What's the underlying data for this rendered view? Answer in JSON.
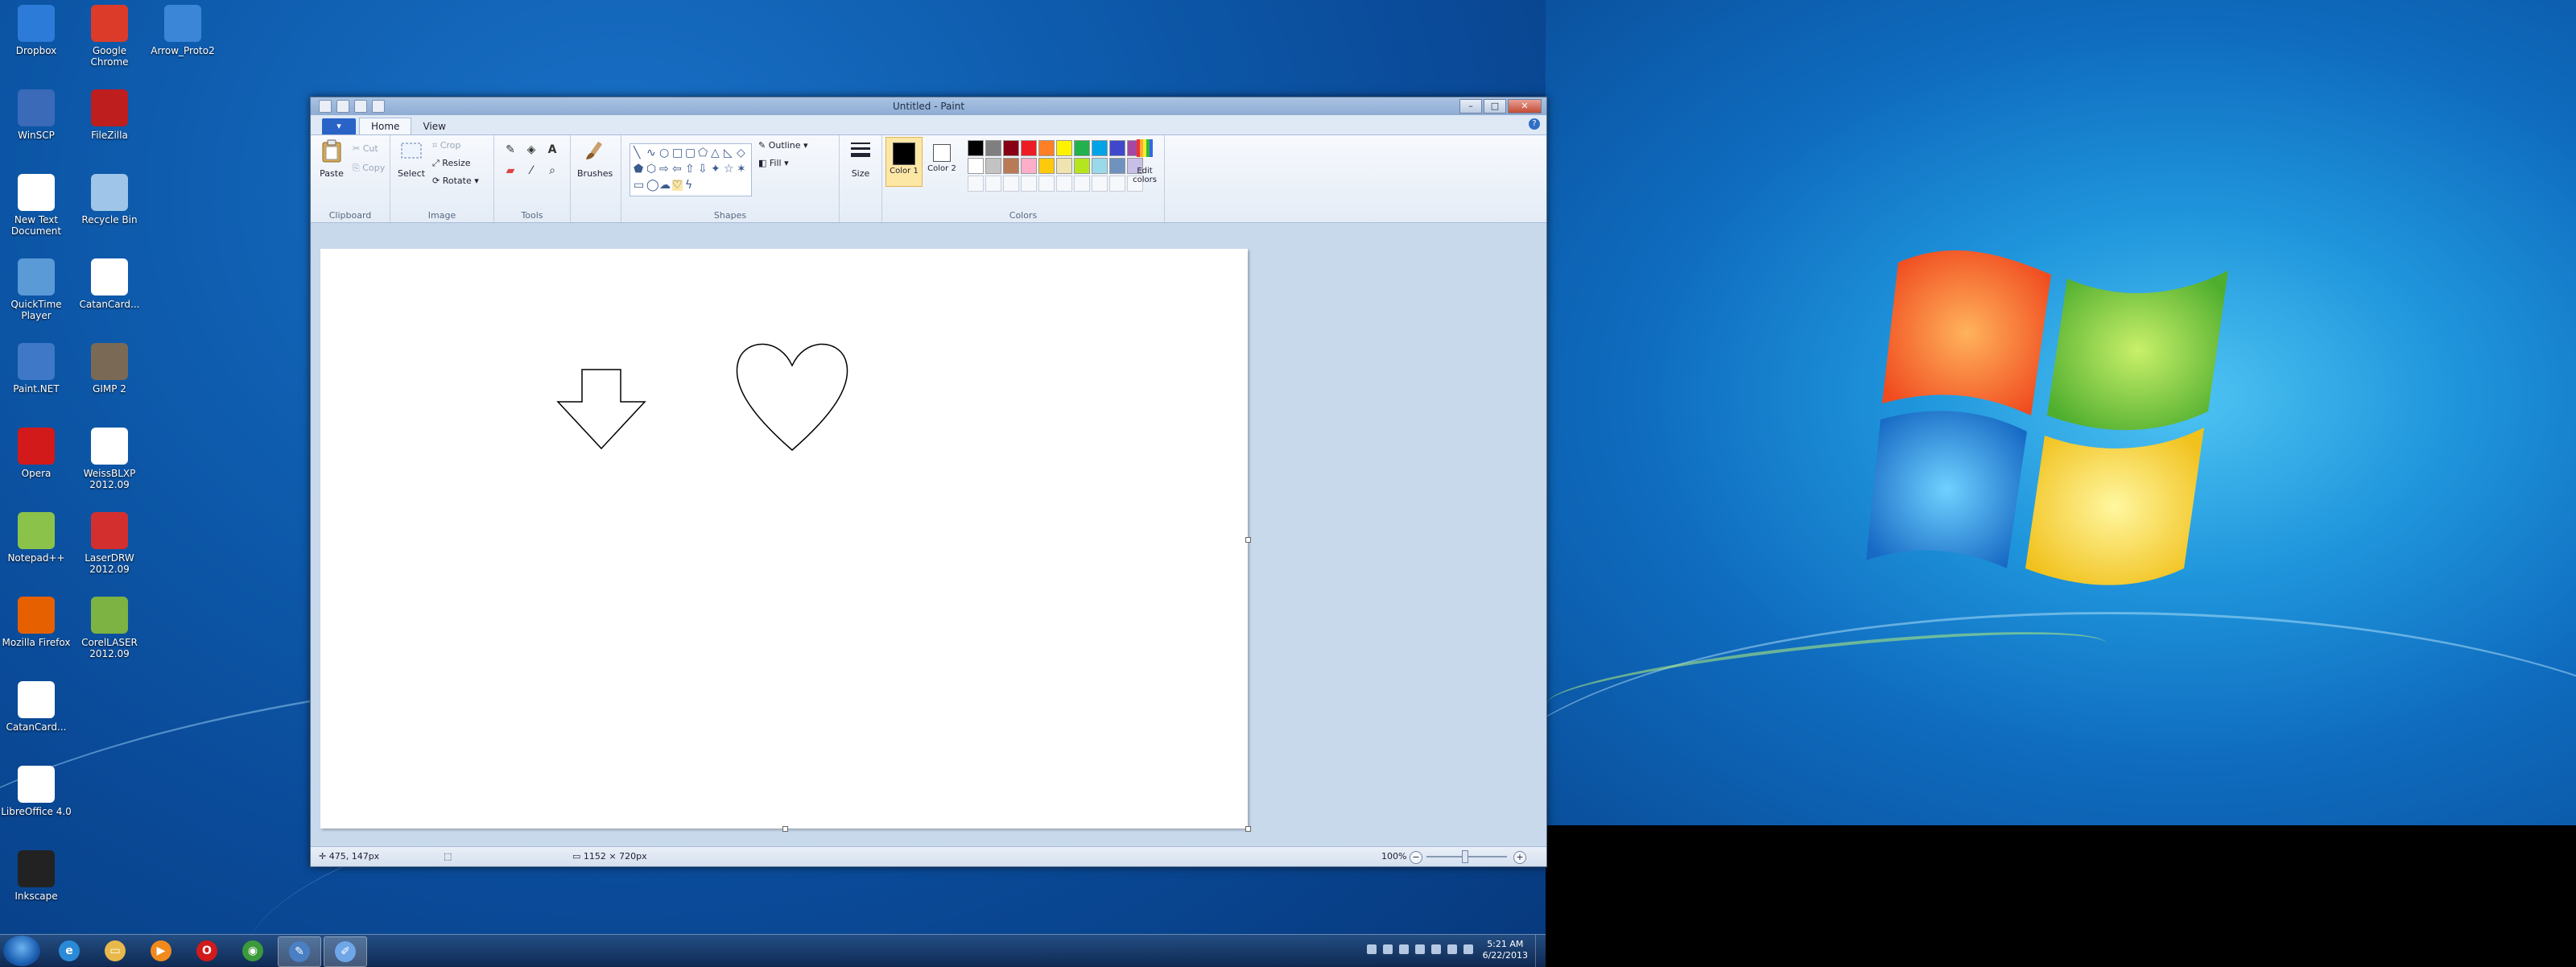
{
  "desktop": {
    "icons": [
      {
        "label": "Dropbox",
        "icon": "dropbox-icon",
        "color": "#2d7bd8"
      },
      {
        "label": "Google Chrome",
        "icon": "chrome-icon",
        "color": "#dd3b2a"
      },
      {
        "label": "Arrow_Proto2",
        "icon": "ie-document-icon",
        "color": "#3b86d6"
      },
      {
        "label": "WinSCP",
        "icon": "winscp-icon",
        "color": "#3a6ab8"
      },
      {
        "label": "FileZilla",
        "icon": "filezilla-icon",
        "color": "#bf1e1e"
      },
      {
        "label": "New Text Document",
        "icon": "text-document-icon",
        "color": "#ffffff"
      },
      {
        "label": "Recycle Bin",
        "icon": "recycle-bin-icon",
        "color": "#9fc5e8"
      },
      {
        "label": "QuickTime Player",
        "icon": "quicktime-icon",
        "color": "#5a9ad6"
      },
      {
        "label": "CatanCard...",
        "icon": "image-file-icon",
        "color": "#ffffff"
      },
      {
        "label": "Paint.NET",
        "icon": "paintnet-icon",
        "color": "#3e78c7"
      },
      {
        "label": "GIMP 2",
        "icon": "gimp-icon",
        "color": "#7a6a55"
      },
      {
        "label": "Opera",
        "icon": "opera-icon",
        "color": "#d21a1a"
      },
      {
        "label": "WeissBLXP 2012.09",
        "icon": "app-icon",
        "color": "#ffffff"
      },
      {
        "label": "Notepad++",
        "icon": "notepadpp-icon",
        "color": "#8bc34a"
      },
      {
        "label": "LaserDRW 2012.09",
        "icon": "laserdrw-icon",
        "color": "#d32f2f"
      },
      {
        "label": "Mozilla Firefox",
        "icon": "firefox-icon",
        "color": "#e66000"
      },
      {
        "label": "CorelLASER 2012.09",
        "icon": "corellaser-icon",
        "color": "#7cb342"
      },
      {
        "label": "CatanCard...",
        "icon": "document-file-icon",
        "color": "#ffffff"
      },
      {
        "label": "LibreOffice 4.0",
        "icon": "libreoffice-icon",
        "color": "#ffffff"
      },
      {
        "label": "Inkscape",
        "icon": "inkscape-icon",
        "color": "#222222"
      }
    ]
  },
  "paint": {
    "title": "Untitled - Paint",
    "window_buttons": [
      "–",
      "□",
      "✕"
    ],
    "tabs": {
      "file": "▾",
      "home": "Home",
      "view": "View"
    },
    "help": "?",
    "clipboard": {
      "paste": "Paste",
      "cut": "Cut",
      "copy": "Copy",
      "label": "Clipboard"
    },
    "image": {
      "select": "Select",
      "crop": "Crop",
      "resize": "Resize",
      "rotate": "Rotate",
      "label": "Image"
    },
    "tools": {
      "label": "Tools"
    },
    "brushes": {
      "label": "Brushes"
    },
    "shapes": {
      "outline": "Outline",
      "fill": "Fill",
      "label": "Shapes"
    },
    "size": {
      "label": "Size"
    },
    "colors": {
      "color1": "Color 1",
      "color2": "Color 2",
      "edit": "Edit colors",
      "label": "Colors",
      "color1_value": "#000000",
      "color2_value": "#ffffff",
      "palette_row1": [
        "#000000",
        "#7f7f7f",
        "#880015",
        "#ed1c24",
        "#ff7f27",
        "#fff200",
        "#22b14c",
        "#00a2e8",
        "#3f48cc",
        "#a349a4"
      ],
      "palette_row2": [
        "#ffffff",
        "#c3c3c3",
        "#b97a57",
        "#ffaec9",
        "#ffc90e",
        "#efe4b0",
        "#b5e61d",
        "#99d9ea",
        "#7092be",
        "#c8bfe7"
      ]
    },
    "status": {
      "cursor_pos": "475, 147px",
      "canvas_size": "1152 × 720px",
      "zoom": "100%"
    }
  },
  "taskbar": {
    "items": [
      {
        "icon": "internet-explorer-icon",
        "color": "#2a8ad8",
        "glyph": "e"
      },
      {
        "icon": "windows-explorer-icon",
        "color": "#e8b94a",
        "glyph": "▭"
      },
      {
        "icon": "media-player-icon",
        "color": "#f08a1c",
        "glyph": "▶"
      },
      {
        "icon": "opera-icon",
        "color": "#d21a1a",
        "glyph": "O"
      },
      {
        "icon": "chrome-icon",
        "color": "#3b9a3b",
        "glyph": "◉"
      },
      {
        "icon": "paint-taskbar-icon",
        "color": "#4a7fc4",
        "glyph": "✎"
      },
      {
        "icon": "paint-active-icon",
        "color": "#6ea6e8",
        "glyph": "✐"
      }
    ],
    "time": "5:21 AM",
    "date": "6/22/2013"
  }
}
